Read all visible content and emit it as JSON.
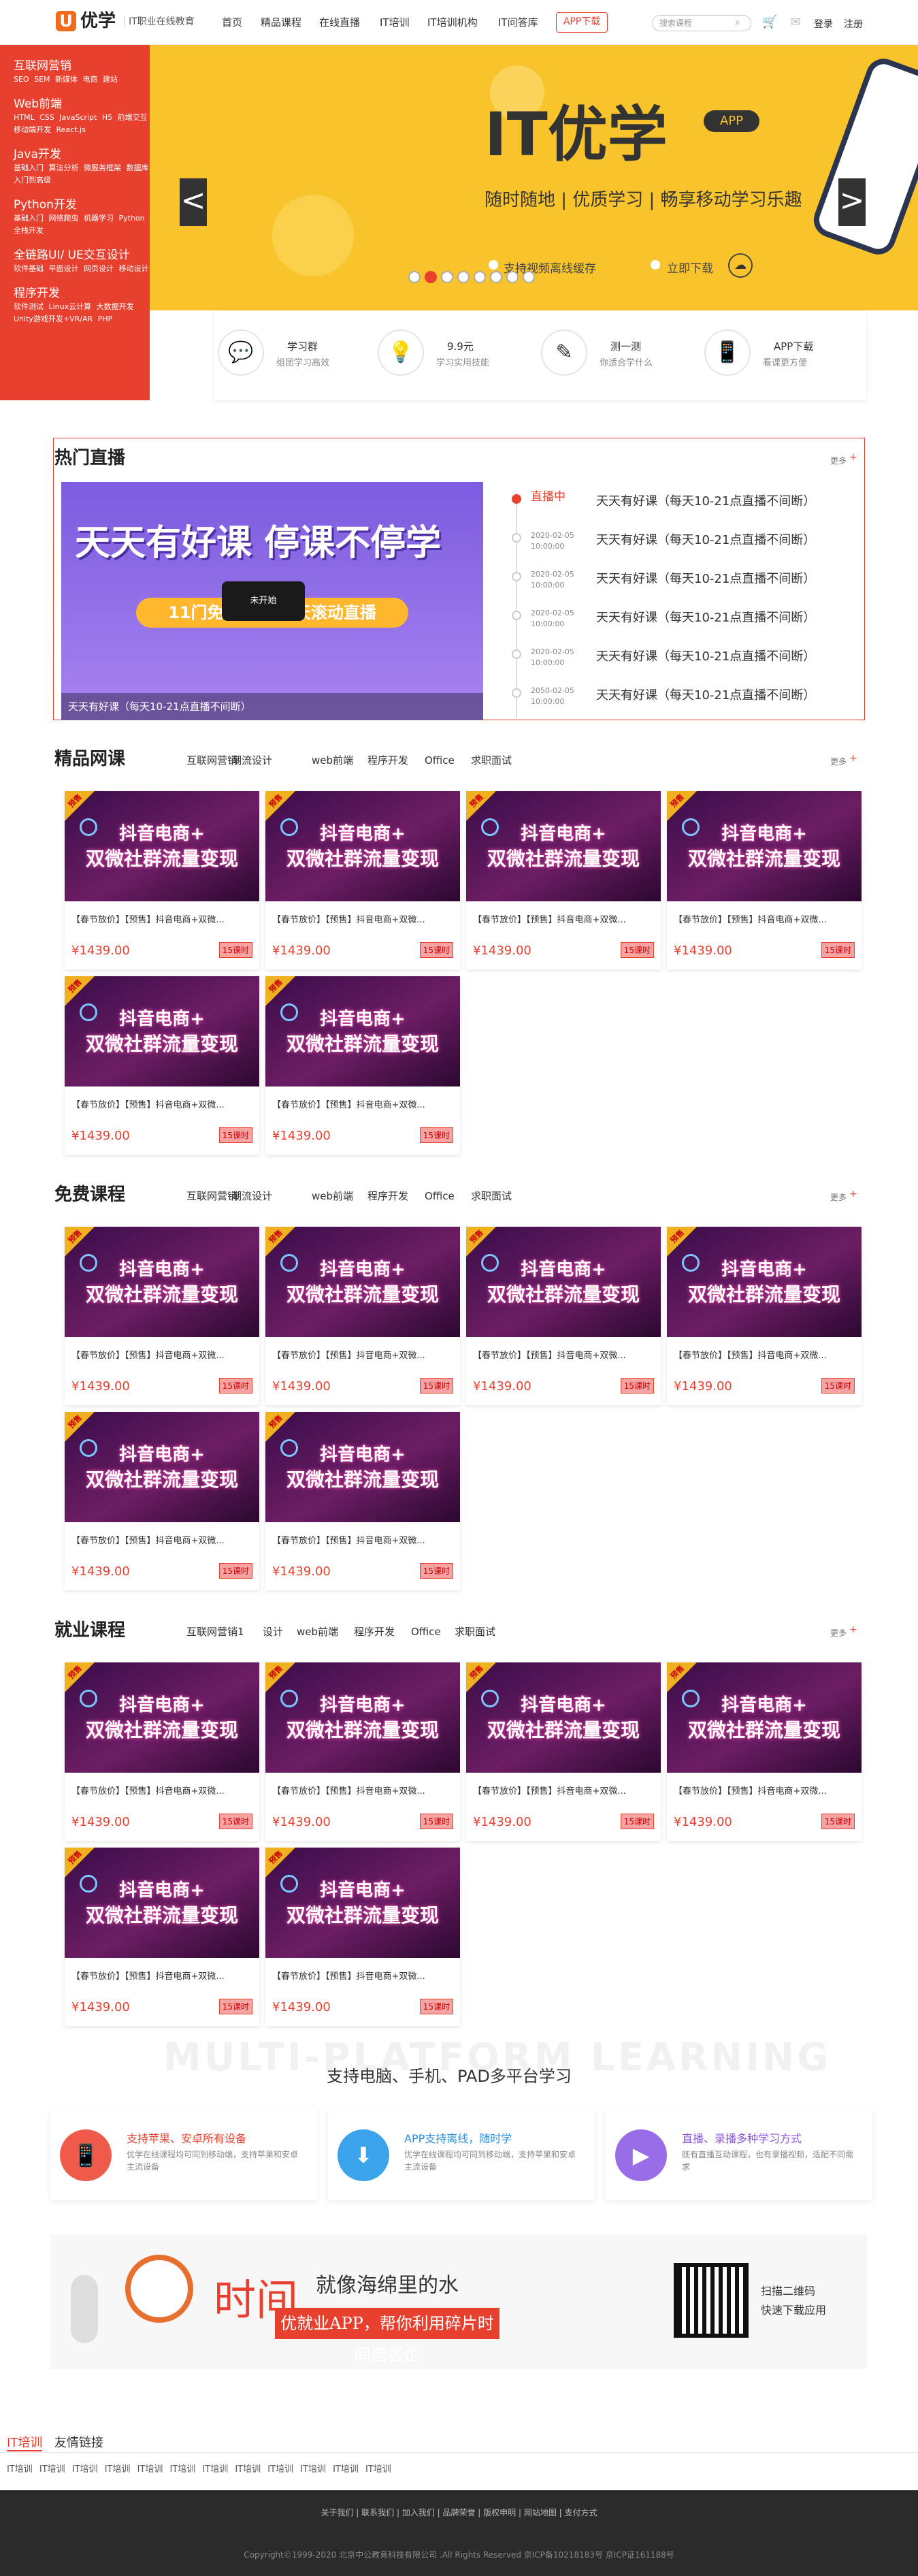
{
  "header": {
    "logo_letter": "U",
    "logo_name": "优学",
    "logo_sub": "IT职业在线教育",
    "nav": [
      "首页",
      "精品课程",
      "在线直播",
      "IT培训",
      "IT培训机构",
      "IT问答库"
    ],
    "app_download": "APP下载",
    "search_placeholder": "搜索课程",
    "login": "登录",
    "register": "注册"
  },
  "sidebar": [
    {
      "title": "互联网营销",
      "links": "SEO SEM 新媒体 电商 建站"
    },
    {
      "title": "Web前端",
      "links": "HTML CSS JavaScript H5 前端交互 移动端开发 React.js"
    },
    {
      "title": "Java开发",
      "links": "基础入门 算法分析 微服务框架 数据库入门到高级"
    },
    {
      "title": "Python开发",
      "links": "基础入门 网络爬虫 机器学习 Python全栈开发"
    },
    {
      "title": "全链路UI/ UE交互设计",
      "links": "软件基础 平面设计 网页设计 移动设计"
    },
    {
      "title": "程序开发",
      "links": "软件测试 Linux云计算 大数据开发 Unity游戏开发+VR/AR PHP"
    }
  ],
  "banner": {
    "title": "IT优学",
    "app_badge": "APP",
    "subtitle": "随时随地 | 优质学习 | 畅享移动学习乐趣",
    "sync": "支持视频离线缓存",
    "download": "立即下载",
    "prev": "<",
    "next": ">"
  },
  "features": [
    {
      "title": "学习群",
      "sub": "组团学习高效",
      "icon": "group-chat-icon",
      "glyph": "💬"
    },
    {
      "title": "9.9元",
      "sub": "学习实用技能",
      "icon": "lightbulb-icon",
      "glyph": "💡"
    },
    {
      "title": "测一测",
      "sub": "你适合学什么",
      "icon": "pencil-icon",
      "glyph": "✎"
    },
    {
      "title": "APP下载",
      "sub": "看课更方便",
      "icon": "phone-icon",
      "glyph": "📱"
    }
  ],
  "live": {
    "title": "热门直播",
    "more": "更多",
    "banner_title": "天天有好课 停课不停学",
    "banner_strip": "11门免费课程 每天滚动直播",
    "badge": "未开始",
    "caption": "天天有好课（每天10-21点直播不间断）",
    "items": [
      {
        "date": "直播中",
        "time": "",
        "text": "天天有好课（每天10-21点直播不间断）"
      },
      {
        "date": "2020-02-05",
        "time": "10:00:00",
        "text": "天天有好课（每天10-21点直播不间断）"
      },
      {
        "date": "2020-02-05",
        "time": "10:00:00",
        "text": "天天有好课（每天10-21点直播不间断）"
      },
      {
        "date": "2020-02-05",
        "time": "10:00:00",
        "text": "天天有好课（每天10-21点直播不间断）"
      },
      {
        "date": "2020-02-05",
        "time": "10:00:00",
        "text": "天天有好课（每天10-21点直播不间断）"
      },
      {
        "date": "2050-02-05",
        "time": "10:00:00",
        "text": "天天有好课（每天10-21点直播不间断）"
      }
    ]
  },
  "course_card": {
    "line1": "抖音电商+",
    "line2": "双微社群流量变现",
    "corner": "预售",
    "title": "【春节放价】【预售】抖音电商+双微...",
    "price": "¥1439.00",
    "badge": "15课时"
  },
  "sections": [
    {
      "title": "精品网课",
      "tabs": [
        "互联网营销",
        "潮流设计",
        "web前端",
        "程序开发",
        "Office",
        "求职面试"
      ],
      "more": "更多"
    },
    {
      "title": "免费课程",
      "tabs": [
        "互联网营销",
        "潮流设计",
        "web前端",
        "程序开发",
        "Office",
        "求职面试"
      ],
      "more": "更多"
    },
    {
      "title": "就业课程",
      "tabs": [
        "互联网营销1",
        "设计",
        "web前端",
        "程序开发",
        "Office",
        "求职面试"
      ],
      "more": "更多"
    }
  ],
  "multi": {
    "bg_text": "MULTI-PLATFORM LEARNING",
    "title": "支持电脑、手机、PAD多平台学习",
    "boxes": [
      {
        "title": "支持苹果、安卓所有设备",
        "sub": "优学在线课程均可同到移动端，支持苹果和安卓主流设备",
        "color": "#ef5a4a",
        "title_color": "#e8402f",
        "glyph": "📱",
        "icon": "mobile-device-icon"
      },
      {
        "title": "APP支持离线，随时学",
        "sub": "优学在线课程均可同到移动端，支持苹果和安卓主流设备",
        "color": "#3ba3ea",
        "title_color": "#2a8ee0",
        "glyph": "⬇",
        "icon": "offline-download-icon"
      },
      {
        "title": "直播、录播多种学习方式",
        "sub": "既有直播互动课程，也有录播视频，适配不同需求",
        "color": "#9b6ce8",
        "title_color": "#8a55e0",
        "glyph": "▶",
        "icon": "video-play-icon"
      }
    ]
  },
  "promo": {
    "time": "时间",
    "line": "就像海绵里的水",
    "bar": "优就业APP，帮你利用碎片时间选各企",
    "qr1": "扫描二维码",
    "qr2": "快速下载应用"
  },
  "friend_links": {
    "tab1": "IT培训",
    "tab2": "友情链接",
    "links": "IT培训 IT培训 IT培训 IT培训 IT培训 IT培训 IT培训 IT培训 IT培训 IT培训 IT培训 IT培训"
  },
  "footer": {
    "links": "关于我们 | 联系我们 | 加入我们 | 品牌荣誉 | 版权申明 | 网站地图 | 支付方式",
    "copyright": "Copyright©1999-2020 北京中公教育科技有限公司 .All Rights Reserved 京ICP备10218183号 京ICP证161188号"
  },
  "colors": {
    "accent": "#e8402f",
    "banner": "#f9c42b",
    "footer": "#2b2b2b"
  }
}
